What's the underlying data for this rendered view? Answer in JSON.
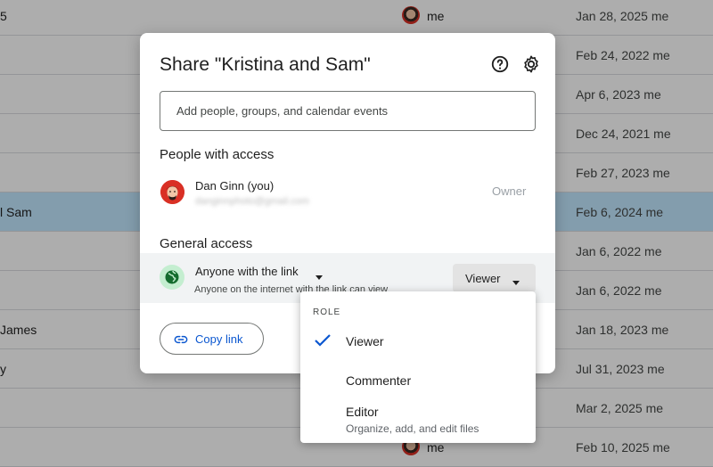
{
  "file_list": {
    "rows": [
      {
        "name": "5",
        "owner_avatar": true,
        "owner": "me",
        "modified": "Jan 28, 2025 me",
        "selected": false
      },
      {
        "name": "",
        "owner_avatar": false,
        "owner": "",
        "modified": "Feb 24, 2022 me",
        "selected": false
      },
      {
        "name": "",
        "owner_avatar": false,
        "owner": "",
        "modified": "Apr 6, 2023 me",
        "selected": false
      },
      {
        "name": "",
        "owner_avatar": false,
        "owner": "",
        "modified": "Dec 24, 2021 me",
        "selected": false
      },
      {
        "name": "",
        "owner_avatar": false,
        "owner": "",
        "modified": "Feb 27, 2023 me",
        "selected": false
      },
      {
        "name": "l Sam",
        "owner_avatar": false,
        "owner": "",
        "modified": "Feb 6, 2024 me",
        "selected": true
      },
      {
        "name": "",
        "owner_avatar": false,
        "owner": "",
        "modified": "Jan 6, 2022 me",
        "selected": false
      },
      {
        "name": "",
        "owner_avatar": false,
        "owner": "",
        "modified": "Jan 6, 2022 me",
        "selected": false
      },
      {
        "name": "James",
        "owner_avatar": false,
        "owner": "",
        "modified": "Jan 18, 2023 me",
        "selected": false
      },
      {
        "name": "y",
        "owner_avatar": false,
        "owner": "",
        "modified": "Jul 31, 2023 me",
        "selected": false
      },
      {
        "name": "",
        "owner_avatar": false,
        "owner": "",
        "modified": "Mar 2, 2025 me",
        "selected": false
      },
      {
        "name": "",
        "owner_avatar": true,
        "owner": "me",
        "modified": "Feb 10, 2025 me",
        "selected": false
      }
    ]
  },
  "share_dialog": {
    "title": "Share \"Kristina and Sam\"",
    "help_icon": "help-circle-icon",
    "settings_icon": "gear-icon",
    "add_people_placeholder": "Add people, groups, and calendar events",
    "people_heading": "People with access",
    "user": {
      "name": "Dan Ginn (you)",
      "email": "danginnphoto@gmail.com",
      "role": "Owner"
    },
    "general_heading": "General access",
    "general_access": {
      "title": "Anyone with the link",
      "description": "Anyone on the internet with the link can view",
      "role": "Viewer",
      "icon": "globe-icon"
    },
    "copy_link_label": "Copy link",
    "colors": {
      "accent": "#0b57d0",
      "selected_row": "#c2e7ff"
    }
  },
  "role_menu": {
    "heading": "ROLE",
    "items": [
      {
        "label": "Viewer",
        "description": "",
        "checked": true
      },
      {
        "label": "Commenter",
        "description": "",
        "checked": false
      },
      {
        "label": "Editor",
        "description": "Organize, add, and edit files",
        "checked": false
      }
    ]
  }
}
